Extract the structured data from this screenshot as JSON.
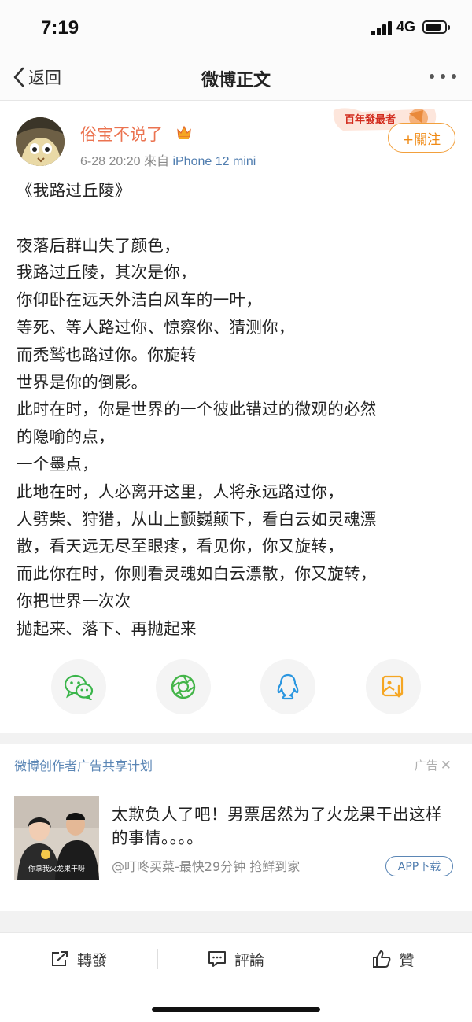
{
  "status_bar": {
    "time": "7:19",
    "network": "4G"
  },
  "nav": {
    "back_label": "返回",
    "title": "微博正文"
  },
  "post": {
    "username": "俗宝不说了",
    "timestamp": "6-28 20:20",
    "source_prefix": "來自",
    "source": "iPhone 12 mini",
    "follow_label": "+關注",
    "banner_text": "百年發最者",
    "content_lines": [
      "《我路过丘陵》",
      "",
      "夜落后群山失了颜色，",
      "我路过丘陵，其次是你，",
      "你仰卧在远天外洁白风车的一叶，",
      "等死、等人路过你、惊察你、猜测你，",
      "而秃鹫也路过你。你旋转",
      "世界是你的倒影。",
      "此时在时，你是世界的一个彼此错过的微观的必然",
      "的隐喻的点，",
      "一个墨点，",
      "此地在时，人必离开这里，人将永远路过你，",
      "人劈柴、狩猎，从山上颤巍颠下，看白云如灵魂漂",
      "散，看天远无尽至眼疼，看见你，你又旋转，",
      "而此你在时，你则看灵魂如白云漂散，你又旋转，",
      "你把世界一次次",
      "抛起来、落下、再抛起来"
    ]
  },
  "share": {
    "icons": [
      "wechat-icon",
      "moments-icon",
      "qq-icon",
      "save-image-icon"
    ]
  },
  "ad": {
    "plan_label": "微博创作者广告共享计划",
    "ad_label": "广告",
    "text": "太欺负人了吧！男票居然为了火龙果干出这样的事情。。。。",
    "thumb_caption": "你拿我火龙果干呀",
    "source": "@叮咚买菜-最快29分钟 抢鲜到家",
    "download_label": "APP下载"
  },
  "toolbar": {
    "repost_label": "轉發",
    "comment_label": "評論",
    "like_label": "贊"
  },
  "colors": {
    "username": "#eb7350",
    "link": "#507daf",
    "follow": "#f08a14",
    "wechat": "#3ab54a",
    "moments": "#44b549",
    "qq": "#2a96e0",
    "save": "#f5a623"
  }
}
